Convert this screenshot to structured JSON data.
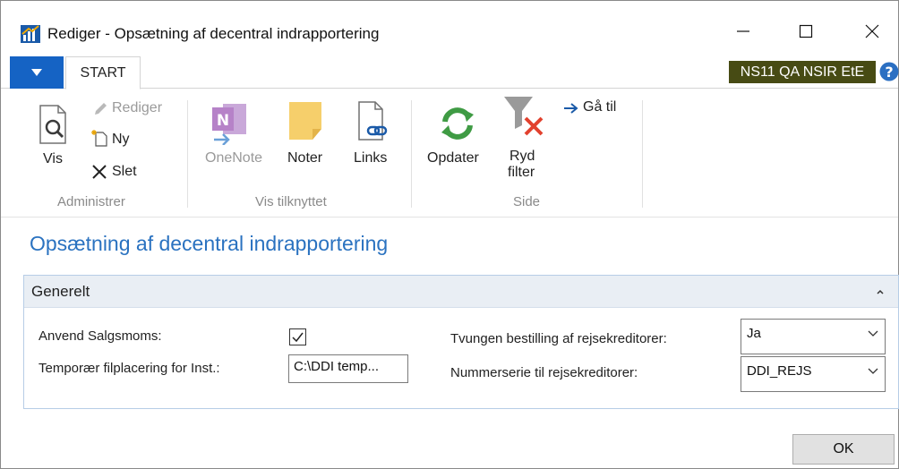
{
  "window": {
    "title": "Rediger - Opsætning af decentral indrapportering"
  },
  "tabs": {
    "start": "START"
  },
  "company": "NS11 QA NSIR EtE",
  "ribbon": {
    "administrer": {
      "label": "Administrer",
      "vis": "Vis",
      "rediger": "Rediger",
      "ny": "Ny",
      "slet": "Slet"
    },
    "vis_tilknyttet": {
      "label": "Vis tilknyttet",
      "onenote": "OneNote",
      "noter": "Noter",
      "links": "Links"
    },
    "side": {
      "label": "Side",
      "opdater": "Opdater",
      "ryd_filter_line1": "Ryd",
      "ryd_filter_line2": "filter",
      "gaa_til": "Gå til"
    }
  },
  "page": {
    "title": "Opsætning af decentral indrapportering"
  },
  "generelt": {
    "header": "Generelt",
    "anvend_salgsmoms_label": "Anvend Salgsmoms:",
    "anvend_salgsmoms_checked": true,
    "temp_fil_label": "Temporær filplacering for Inst.:",
    "temp_fil_value": "C:\\DDI temp...",
    "tvungen_label": "Tvungen bestilling af rejsekreditorer:",
    "tvungen_value": "Ja",
    "nummerserie_label": "Nummerserie til rejsekreditorer:",
    "nummerserie_value": "DDI_REJS"
  },
  "footer": {
    "ok_label": "OK"
  },
  "colors": {
    "accent": "#1563c4",
    "page_title": "#2a72c0",
    "company_badge": "#474b14",
    "fasttab_header": "#e9eef4"
  }
}
